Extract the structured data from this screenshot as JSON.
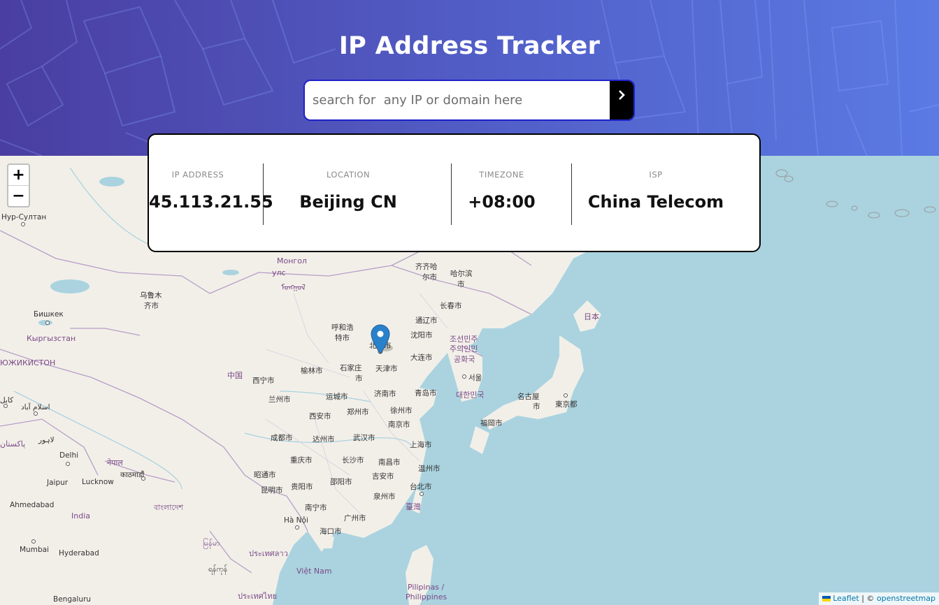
{
  "header": {
    "title": "IP Address Tracker",
    "search_placeholder": "search for  any IP or domain here",
    "search_value": "",
    "search_button_icon": "chevron-right-icon"
  },
  "info": {
    "ip": {
      "label": "IP ADDRESS",
      "value": "45.113.21.55"
    },
    "location": {
      "label": "LOCATION",
      "value": "Beijing CN"
    },
    "timezone": {
      "label": "TIMEZONE",
      "value": "+08:00"
    },
    "isp": {
      "label": "ISP",
      "value": "China Telecom"
    }
  },
  "map": {
    "zoom_in": "+",
    "zoom_out": "−",
    "marker_icon": "map-pin-icon",
    "attribution": {
      "leaflet": "Leaflet",
      "separator": "|",
      "copyright": "©",
      "osm": "openstreetmap"
    },
    "labels": [
      "Нур-Султан",
      "Монгол",
      "улс",
      "ᠮᠣᠩᠭᠣᠯ",
      "齐齐哈",
      "尔市",
      "哈尔滨",
      "市",
      "乌鲁木",
      "齐市",
      "Бишкек",
      "Кыргызстан",
      "长春市",
      "通辽市",
      "呼和浩",
      "特市",
      "北京市",
      "沈阳市",
      "조선민주",
      "주의인민",
      "공화국",
      "大连市",
      "天津市",
      "榆林市",
      "石家庄",
      "市",
      "中国",
      "西宁市",
      "济南市",
      "서울",
      "日本",
      "兰州市",
      "运城市",
      "青岛市",
      "대한민국",
      "名古屋",
      "市",
      "東京都",
      "西安市",
      "郑州市",
      "徐州市",
      "南京市",
      "福岡市",
      "成都市",
      "达州市",
      "武汉市",
      "上海市",
      "Delhi",
      "नेपाल",
      "काठमाडौं",
      "重庆市",
      "长沙市",
      "南昌市",
      "温州市",
      "Jaipur",
      "Lucknow",
      "昭通市",
      "贵阳市",
      "邵阳市",
      "吉安市",
      "台北市",
      "昆明市",
      "泉州市",
      "臺灣",
      "Ahmedabad",
      "বাংলাদেশ",
      "India",
      "南宁市",
      "广州市",
      "Hà Nội",
      "海口市",
      "Mumbai",
      "Hyderabad",
      "မြန်မာ",
      "ประเทศลาว",
      "Việt Nam",
      "ရန်ကုန်",
      "Pilipinas /",
      "Philippines",
      "Bengaluru",
      "ประเทศไทย",
      "ЮЖИКИСТОН",
      "کابل",
      "اسلام آباد",
      "لاہور",
      "پاکستان"
    ]
  }
}
